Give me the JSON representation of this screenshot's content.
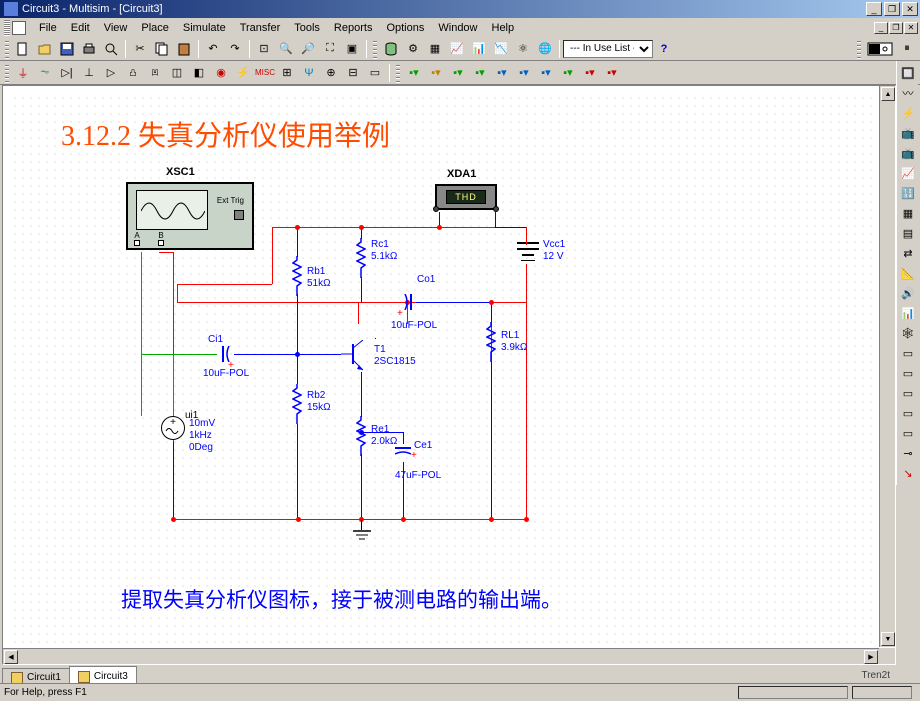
{
  "window": {
    "title": "Circuit3 - Multisim - [Circuit3]"
  },
  "menu": [
    "File",
    "Edit",
    "View",
    "Place",
    "Simulate",
    "Transfer",
    "Tools",
    "Reports",
    "Options",
    "Window",
    "Help"
  ],
  "toolbar": {
    "use_list": "--- In Use List ---"
  },
  "canvas": {
    "title": "3.12.2  失真分析仪使用举例",
    "instructions": "提取失真分析仪图标，接于被测电路的输出端。"
  },
  "instruments": {
    "scope": {
      "name": "XSC1",
      "ext": "Ext Trig",
      "portA": "A",
      "portB": "B"
    },
    "analyzer": {
      "name": "XDA1",
      "lcd": "THD"
    }
  },
  "components": {
    "vcc": {
      "name": "Vcc1",
      "val": "12 V"
    },
    "rc1": {
      "name": "Rc1",
      "val": "5.1kΩ"
    },
    "rb1": {
      "name": "Rb1",
      "val": "51kΩ"
    },
    "rb2": {
      "name": "Rb2",
      "val": "15kΩ"
    },
    "re1": {
      "name": "Re1",
      "val": "2.0kΩ"
    },
    "rl1": {
      "name": "RL1",
      "val": "3.9kΩ"
    },
    "co1": {
      "name": "Co1",
      "val": "10uF-POL"
    },
    "ci1": {
      "name": "Ci1",
      "val": "10uF-POL"
    },
    "ce1": {
      "name": "Ce1",
      "val": "47uF-POL"
    },
    "t1": {
      "name": "T1",
      "val": "2SC1815"
    },
    "src": {
      "name": "ui1",
      "v": "10mV",
      "f": "1kHz",
      "p": "0Deg"
    }
  },
  "tabs": [
    {
      "label": "Circuit1"
    },
    {
      "label": "Circuit3"
    }
  ],
  "status": {
    "help": "For Help, press F1"
  },
  "watermark": "Tren2t"
}
